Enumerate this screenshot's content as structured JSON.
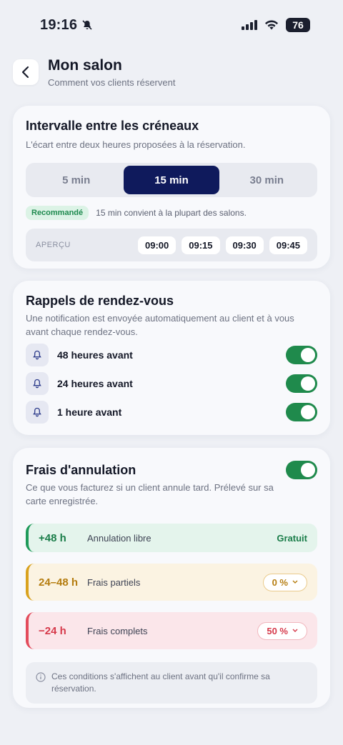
{
  "status_bar": {
    "time": "19:16",
    "battery": "76"
  },
  "header": {
    "title": "Mon salon",
    "subtitle": "Comment vos clients réservent"
  },
  "interval": {
    "title": "Intervalle entre les créneaux",
    "description": "L'écart entre deux heures proposées à la réservation.",
    "options": [
      "5 min",
      "15 min",
      "30 min"
    ],
    "selected": "15 min",
    "badge": "Recommandé",
    "note": "15 min convient à la plupart des salons.",
    "preview_label": "APERÇU",
    "preview_slots": [
      "09:00",
      "09:15",
      "09:30",
      "09:45"
    ]
  },
  "reminders": {
    "title": "Rappels de rendez-vous",
    "description": "Une notification est envoyée automatiquement au client et à vous avant chaque rendez-vous.",
    "items": [
      {
        "label": "48 heures avant",
        "enabled": true
      },
      {
        "label": "24 heures avant",
        "enabled": true
      },
      {
        "label": "1 heure avant",
        "enabled": true
      }
    ]
  },
  "cancellation": {
    "title": "Frais d'annulation",
    "enabled": true,
    "description": "Ce que vous facturez si un client annule tard. Prélevé sur sa carte enregistrée.",
    "tiers": [
      {
        "hours": "+48 h",
        "label": "Annulation libre",
        "value": "Gratuit",
        "color": "#1f9a5a"
      },
      {
        "hours": "24–48 h",
        "label": "Frais partiels",
        "value": "0 %",
        "color": "#d9a21f"
      },
      {
        "hours": "−24 h",
        "label": "Frais complets",
        "value": "50 %",
        "color": "#e34c5c"
      }
    ],
    "info": "Ces conditions s'affichent au client avant qu'il confirme sa réservation."
  },
  "colors": {
    "accent": "#0f1a5c",
    "toggle_on": "#1f8a4c"
  }
}
